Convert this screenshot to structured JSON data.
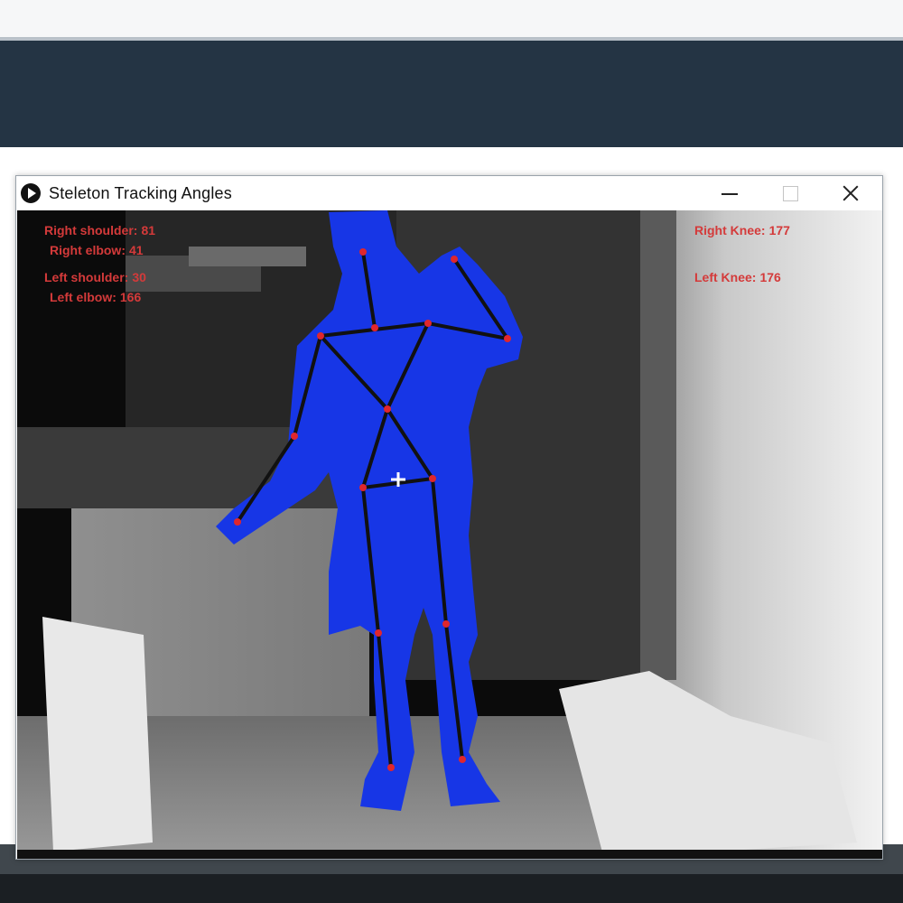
{
  "window": {
    "title": "Steleton  Tracking  Angles",
    "icon": "processing-play-icon"
  },
  "angles": {
    "right_shoulder": {
      "label": "Right shoulder:",
      "value": "81"
    },
    "right_elbow": {
      "label": "Right elbow:",
      "value": "41"
    },
    "left_shoulder": {
      "label": "Left shoulder:",
      "value": "30"
    },
    "left_elbow": {
      "label": "Left elbow:",
      "value": "166"
    },
    "right_knee": {
      "label": "Right Knee:",
      "value": "177"
    },
    "left_knee": {
      "label": "Left Knee:",
      "value": "176"
    }
  },
  "colors": {
    "body_silhouette": "#1736e6",
    "skeleton_line": "#111111",
    "joint": "#e0262d",
    "angle_text": "#d43a3a",
    "center_marker": "#ffffff"
  }
}
